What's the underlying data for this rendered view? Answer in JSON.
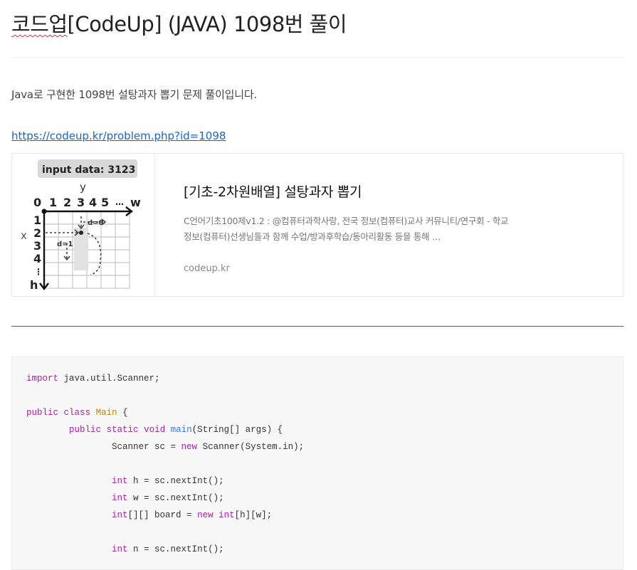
{
  "post": {
    "title_prefix": "코드업",
    "title_rest": "[CodeUp] (JAVA) 1098번 풀이",
    "intro": "Java로 구현한 1098번 설탕과자 뽑기 문제 풀이입니다.",
    "link": "https://codeup.kr/problem.php?id=1098"
  },
  "og_card": {
    "title": "[기초-2차원배열] 설탕과자 뽑기",
    "description": "C언어기초100제v1.2 : @컴퓨터과학사랑, 전국 정보(컴퓨터)교사 커뮤니티/연구회 - 학교 정보(컴퓨터)선생님들과 함께 수업/방과후학습/동아리활동 등을 통해 …",
    "site": "codeup.kr",
    "thumbnail": {
      "input_label": "input data: 3123",
      "axis_y": "y",
      "axis_x": "x",
      "col_labels": [
        "0",
        "1",
        "2",
        "3",
        "4",
        "5",
        "…",
        "w"
      ],
      "row_labels": [
        "1",
        "2",
        "3",
        "4",
        "⋮",
        "h"
      ],
      "annot_d0": "d=0",
      "annot_d1": "d=1"
    }
  },
  "code": {
    "lines": [
      "import java.util.Scanner;",
      "",
      "public class Main {",
      "        public static void main(String[] args) {",
      "                Scanner sc = new Scanner(System.in);",
      "",
      "                int h = sc.nextInt();",
      "                int w = sc.nextInt();",
      "                int[][] board = new int[h][w];",
      "",
      "                int n = sc.nextInt();"
    ]
  }
}
